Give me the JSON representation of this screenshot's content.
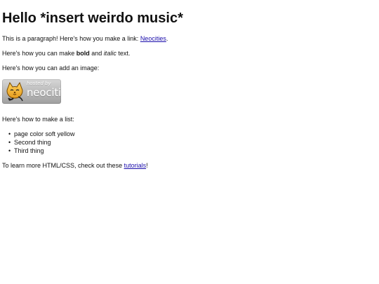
{
  "page": {
    "heading": "Hello *insert weirdo music*",
    "paragraph_intro": "This is a paragraph! Here's how you make a link: ",
    "link_neocities": "Neocities",
    "paragraph_intro_end": ".",
    "bold_line_prefix": "Here's how you can make ",
    "bold_text": "bold",
    "bold_line_middle": " and ",
    "italic_text": "italic",
    "bold_line_end": " text.",
    "image_line": "Here's how you can add an image:",
    "badge_small": "hosted by",
    "badge_brand": "neocities",
    "list_intro": "Here's how to make a list:",
    "list_items": [
      "page color soft yellow",
      "Second thing",
      "Third thing"
    ],
    "tutorial_prefix": "To learn more HTML/CSS, check out these ",
    "tutorial_link": "tutorials",
    "tutorial_end": "!"
  }
}
